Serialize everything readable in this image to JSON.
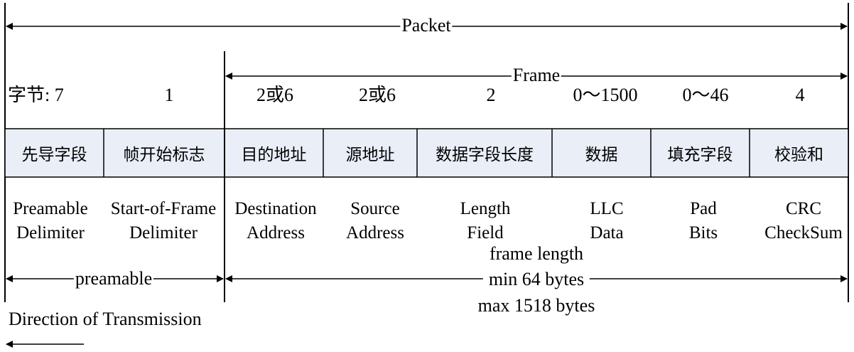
{
  "packet_label": "Packet",
  "frame_label": "Frame",
  "bytes_prefix": "字节: 7",
  "byte_counts": [
    "1",
    "2或6",
    "2或6",
    "2",
    "0～1500",
    "0～46",
    "4"
  ],
  "fields_cn": [
    "先导字段",
    "帧开始标志",
    "目的地址",
    "源地址",
    "数据字段长度",
    "数据",
    "填充字段",
    "校验和"
  ],
  "fields_en": [
    {
      "line1": "Preamable",
      "line2": "Delimiter"
    },
    {
      "line1": "Start-of-Frame",
      "line2": "Delimiter"
    },
    {
      "line1": "Destination",
      "line2": "Address"
    },
    {
      "line1": "Source",
      "line2": "Address"
    },
    {
      "line1": "Length",
      "line2": "Field"
    },
    {
      "line1": "LLC",
      "line2": "Data"
    },
    {
      "line1": "Pad",
      "line2": "Bits"
    },
    {
      "line1": "CRC",
      "line2": "CheckSum"
    }
  ],
  "preamble_label": "preamable",
  "frame_length": {
    "line1": "frame length",
    "line2": "min 64 bytes",
    "line3": "max 1518 bytes"
  },
  "direction_label": "Direction of Transmission",
  "colors": {
    "cell_fill": "#e9eef7",
    "line": "#000000",
    "background": "#ffffff"
  }
}
